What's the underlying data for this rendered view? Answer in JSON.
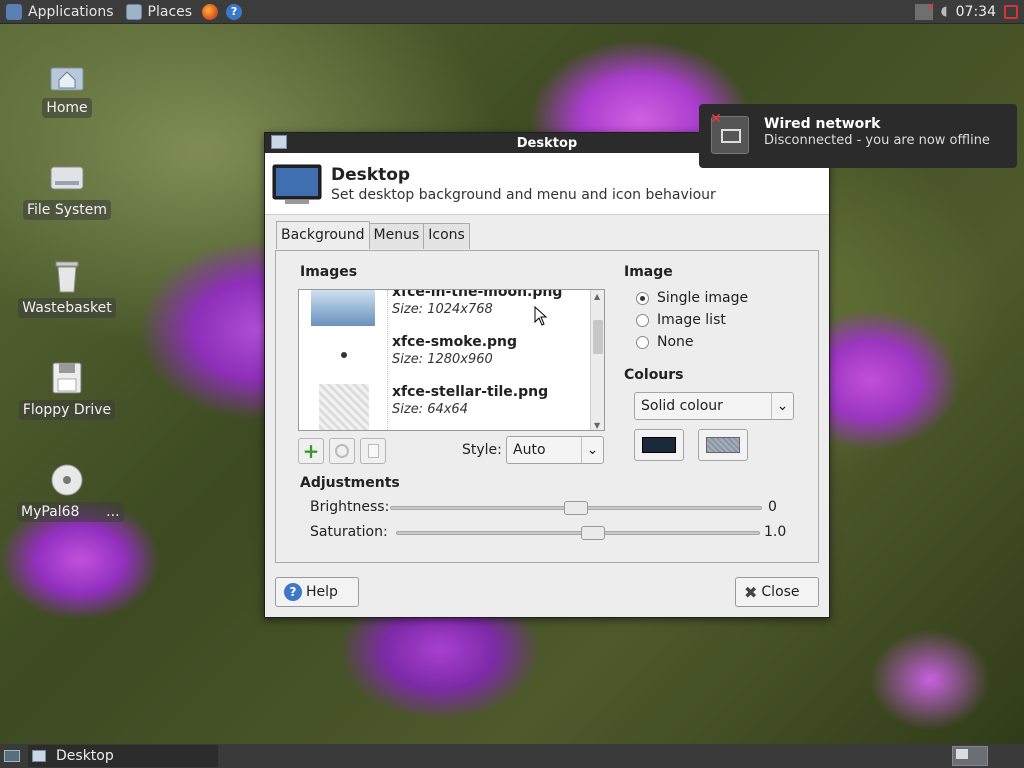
{
  "top_panel": {
    "applications_label": "Applications",
    "places_label": "Places",
    "clock": "07:34"
  },
  "desktop_icons": [
    {
      "label": "Home"
    },
    {
      "label": "File System"
    },
    {
      "label": "Wastebasket"
    },
    {
      "label": "Floppy Drive"
    },
    {
      "label": "MyPal68      ..."
    }
  ],
  "notification": {
    "title": "Wired network",
    "body": "Disconnected - you are now offline"
  },
  "dialog": {
    "window_title": "Desktop",
    "header_title": "Desktop",
    "header_subtitle": "Set desktop background and menu and icon behaviour",
    "tabs": [
      "Background",
      "Menus",
      "Icons"
    ],
    "active_tab": "Background",
    "images_section": "Images",
    "images": [
      {
        "name": "xfce-in-the-moon.png",
        "size": "Size: 1024x768"
      },
      {
        "name": "xfce-smoke.png",
        "size": "Size: 1280x960"
      },
      {
        "name": "xfce-stellar-tile.png",
        "size": "Size: 64x64"
      }
    ],
    "style_label": "Style:",
    "style_value": "Auto",
    "image_section": "Image",
    "image_options": [
      "Single image",
      "Image list",
      "None"
    ],
    "image_selected": "Single image",
    "colours_section": "Colours",
    "colour_mode": "Solid colour",
    "primary_colour": "#1b2a3a",
    "adjustments_section": "Adjustments",
    "brightness_label": "Brightness:",
    "brightness_value": "0",
    "saturation_label": "Saturation:",
    "saturation_value": "1.0",
    "help_label": "Help",
    "close_label": "Close"
  },
  "taskbar": {
    "task_label": "Desktop"
  }
}
